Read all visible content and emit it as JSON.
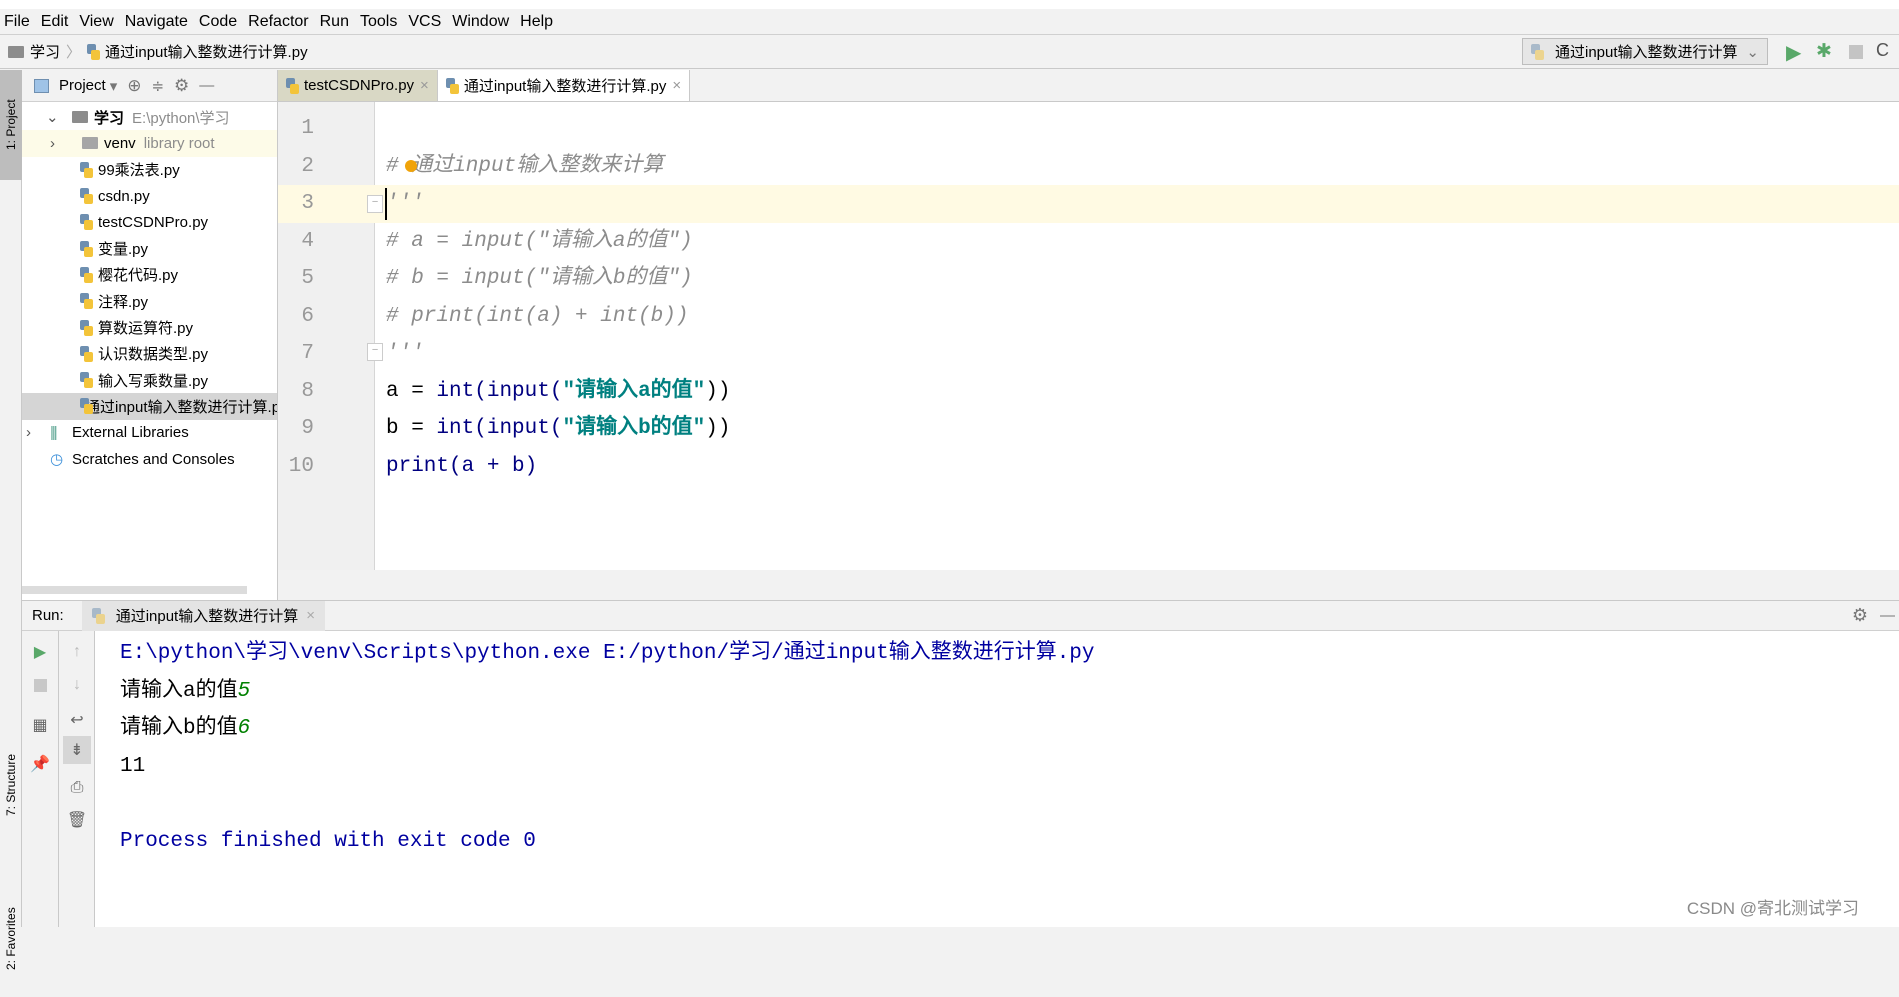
{
  "menu": [
    "File",
    "Edit",
    "View",
    "Navigate",
    "Code",
    "Refactor",
    "Run",
    "Tools",
    "VCS",
    "Window",
    "Help"
  ],
  "breadcrumb": {
    "folder": "学习",
    "file": "通过input输入整数进行计算.py"
  },
  "run_config": {
    "label": "通过input输入整数进行计算"
  },
  "left_strip": {
    "project": "1: Project",
    "structure": "7: Structure",
    "favorites": "2: Favorites"
  },
  "project": {
    "title": "Project",
    "root": {
      "name": "学习",
      "path": "E:\\python\\学习"
    },
    "venv": {
      "name": "venv",
      "note": "library root"
    },
    "files": [
      "99乘法表.py",
      "csdn.py",
      "testCSDNPro.py",
      "变量.py",
      "樱花代码.py",
      "注释.py",
      "算数运算符.py",
      "认识数据类型.py",
      "输入写乘数量.py",
      "通过input输入整数进行计算.py"
    ],
    "external": "External Libraries",
    "scratches": "Scratches and Consoles"
  },
  "tabs": [
    {
      "label": "testCSDNPro.py",
      "active": false
    },
    {
      "label": "通过input输入整数进行计算.py",
      "active": true
    }
  ],
  "code": {
    "line_numbers": [
      "1",
      "2",
      "3",
      "4",
      "5",
      "6",
      "7",
      "8",
      "9",
      "10"
    ],
    "l2": "# 通过input输入整数来计算",
    "l3": "'''",
    "l4": "# a = input(\"请输入a的值\")",
    "l5": "# b = input(\"请输入b的值\")",
    "l6": "# print(int(a) + int(b))",
    "l7": "'''",
    "l8": {
      "a": "a = ",
      "int": "int(",
      "input": "input(",
      "str": "\"请输入a的值\"",
      "end": "))"
    },
    "l9": {
      "a": "b = ",
      "int": "int(",
      "input": "input(",
      "str": "\"请输入b的值\"",
      "end": "))"
    },
    "l10": "print(a + b)"
  },
  "run": {
    "label": "Run:",
    "tab": "通过input输入整数进行计算",
    "console": {
      "cmd": "E:\\python\\学习\\venv\\Scripts\\python.exe E:/python/学习/通过input输入整数进行计算.py",
      "prompt_a": "请输入a的值",
      "input_a": "5",
      "prompt_b": "请输入b的值",
      "input_b": "6",
      "result": "11",
      "exit": "Process finished with exit code 0"
    }
  },
  "watermark": "CSDN @寄北测试学习",
  "colors": {
    "keyword": "#000080",
    "string": "#008080",
    "comment": "#8c8c8c",
    "console_blue": "#0000a0",
    "user_input": "#008000",
    "caret_line": "#fffae3",
    "run_green": "#59a869"
  }
}
